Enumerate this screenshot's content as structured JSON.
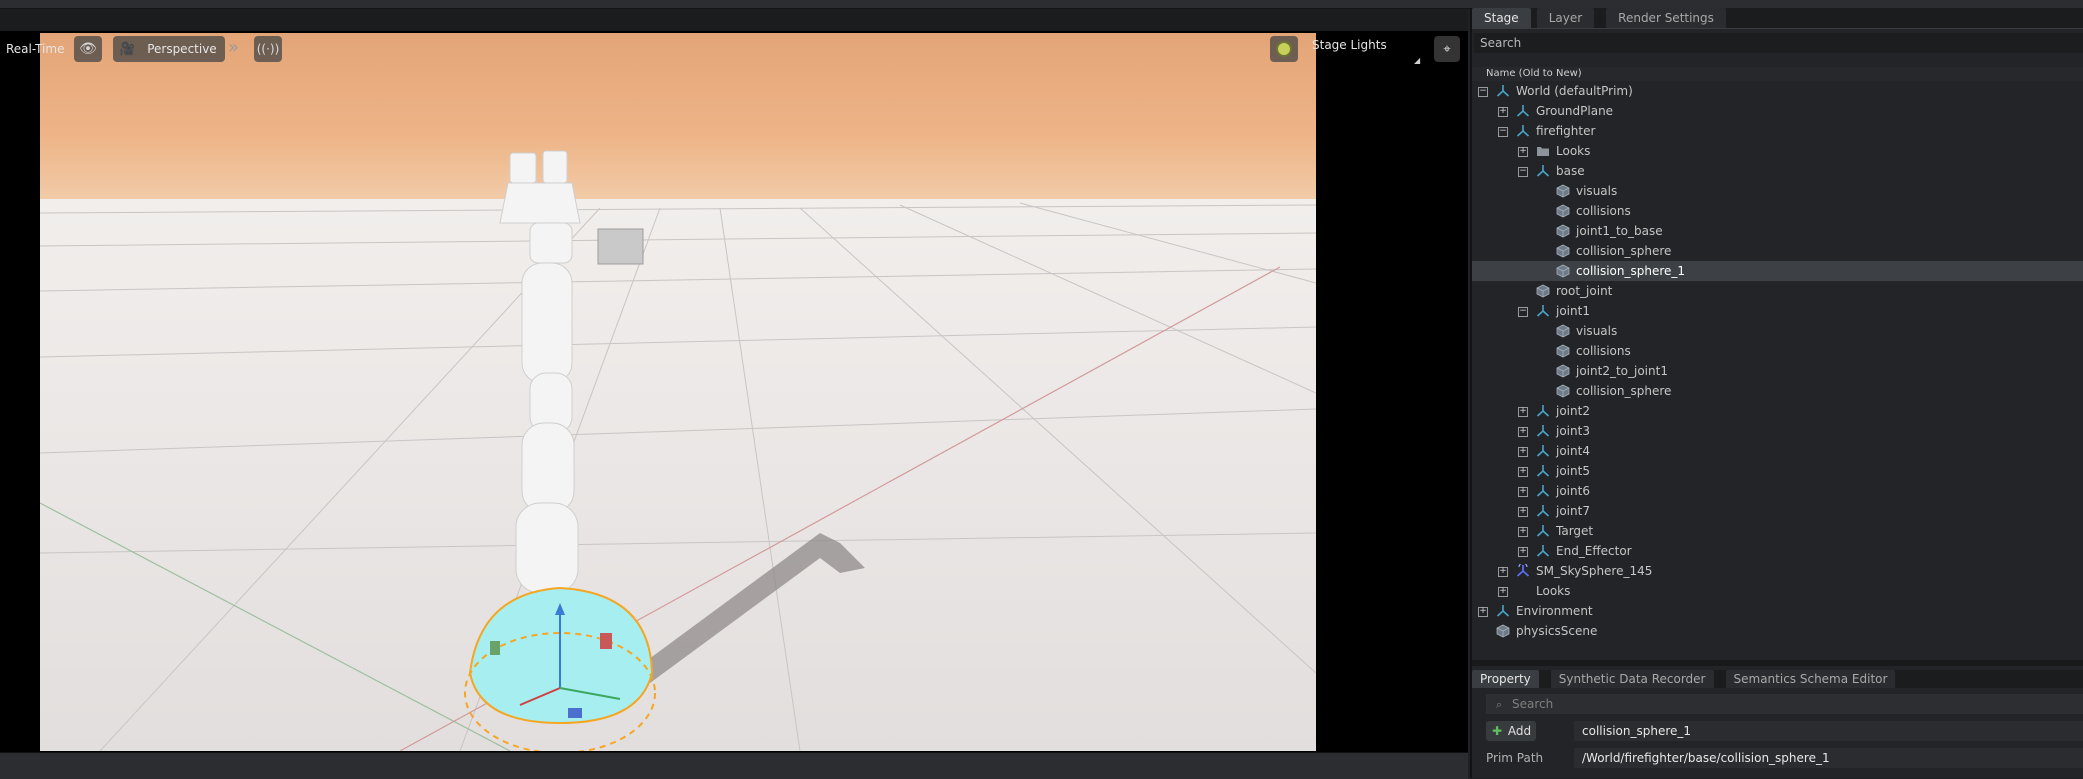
{
  "viewport": {
    "realtime_label": "Real-Time",
    "camera_label": "Perspective",
    "lights_label": "Stage Lights"
  },
  "stage_panel": {
    "tabs": [
      "Stage",
      "Layer",
      "Render Settings"
    ],
    "active_tab": "Stage",
    "search_placeholder": "Search",
    "column_header": "Name (Old to New)",
    "tree": [
      {
        "label": "World (defaultPrim)",
        "depth": 0,
        "expander": "minus",
        "icon": "xform-icon"
      },
      {
        "label": "GroundPlane",
        "depth": 1,
        "expander": "plus",
        "icon": "xform-icon"
      },
      {
        "label": "firefighter",
        "depth": 1,
        "expander": "minus",
        "icon": "xform-icon"
      },
      {
        "label": "Looks",
        "depth": 2,
        "expander": "plus",
        "icon": "folder-icon"
      },
      {
        "label": "base",
        "depth": 2,
        "expander": "minus",
        "icon": "xform-icon"
      },
      {
        "label": "visuals",
        "depth": 3,
        "expander": "",
        "icon": "mesh-icon"
      },
      {
        "label": "collisions",
        "depth": 3,
        "expander": "",
        "icon": "mesh-icon"
      },
      {
        "label": "joint1_to_base",
        "depth": 3,
        "expander": "",
        "icon": "mesh-icon"
      },
      {
        "label": "collision_sphere",
        "depth": 3,
        "expander": "",
        "icon": "mesh-icon"
      },
      {
        "label": "collision_sphere_1",
        "depth": 3,
        "expander": "",
        "icon": "mesh-icon",
        "selected": true
      },
      {
        "label": "root_joint",
        "depth": 2,
        "expander": "",
        "icon": "mesh-icon"
      },
      {
        "label": "joint1",
        "depth": 2,
        "expander": "minus",
        "icon": "xform-icon"
      },
      {
        "label": "visuals",
        "depth": 3,
        "expander": "",
        "icon": "mesh-icon"
      },
      {
        "label": "collisions",
        "depth": 3,
        "expander": "",
        "icon": "mesh-icon"
      },
      {
        "label": "joint2_to_joint1",
        "depth": 3,
        "expander": "",
        "icon": "mesh-icon"
      },
      {
        "label": "collision_sphere",
        "depth": 3,
        "expander": "",
        "icon": "mesh-icon"
      },
      {
        "label": "joint2",
        "depth": 2,
        "expander": "plus",
        "icon": "xform-icon"
      },
      {
        "label": "joint3",
        "depth": 2,
        "expander": "plus",
        "icon": "xform-icon"
      },
      {
        "label": "joint4",
        "depth": 2,
        "expander": "plus",
        "icon": "xform-icon"
      },
      {
        "label": "joint5",
        "depth": 2,
        "expander": "plus",
        "icon": "xform-icon"
      },
      {
        "label": "joint6",
        "depth": 2,
        "expander": "plus",
        "icon": "xform-icon"
      },
      {
        "label": "joint7",
        "depth": 2,
        "expander": "plus",
        "icon": "xform-icon"
      },
      {
        "label": "Target",
        "depth": 2,
        "expander": "plus",
        "icon": "xform-icon"
      },
      {
        "label": "End_Effector",
        "depth": 2,
        "expander": "plus",
        "icon": "xform-icon"
      },
      {
        "label": "SM_SkySphere_145",
        "depth": 1,
        "expander": "plus",
        "icon": "skysphere-icon"
      },
      {
        "label": "Looks",
        "depth": 1,
        "expander": "plus",
        "icon": "none"
      },
      {
        "label": "Environment",
        "depth": 0,
        "expander": "plus",
        "icon": "xform-icon"
      },
      {
        "label": "physicsScene",
        "depth": 0,
        "expander": "",
        "icon": "mesh-icon"
      }
    ]
  },
  "property_panel": {
    "tabs": [
      "Property",
      "Synthetic Data Recorder",
      "Semantics Schema Editor"
    ],
    "active_tab": "Property",
    "search_placeholder": "Search",
    "add_label": "Add",
    "name_value": "collision_sphere_1",
    "prim_path_label": "Prim Path",
    "prim_path_value": "/World/firefighter/base/collision_sphere_1"
  },
  "colors": {
    "selection": "#3d4146",
    "xform_icon": "#4aa3c9",
    "mesh_icon": "#7d8a96",
    "gizmo_orange": "#f5a623",
    "collision_cyan": "#a6eef0"
  }
}
